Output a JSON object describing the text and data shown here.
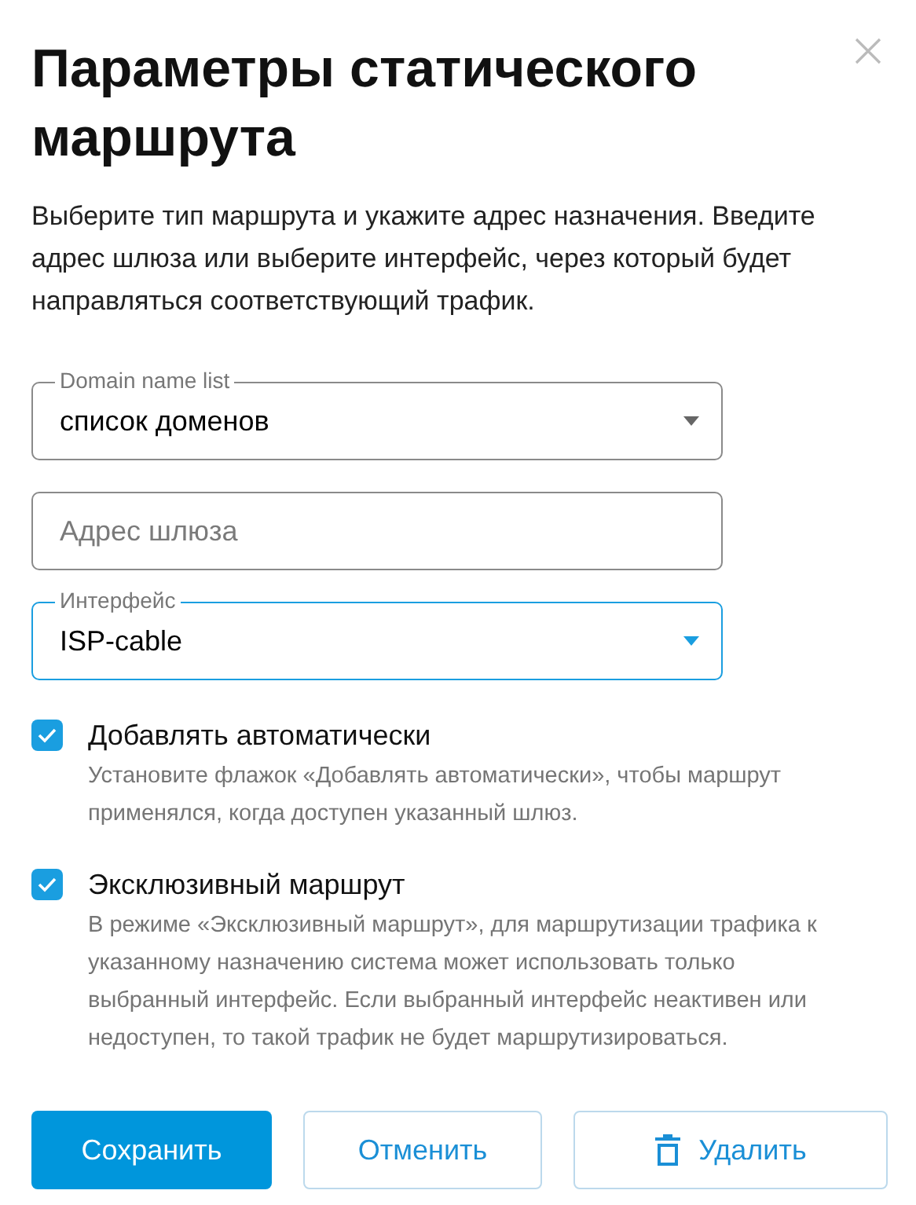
{
  "dialog": {
    "title": "Параметры статического маршрута",
    "description": "Выберите тип маршрута и укажите адрес назначения. Введите адрес шлюза или выберите интерфейс, через который будет направляться соответствующий трафик.",
    "fields": [
      {
        "kind": "select",
        "label": "Domain name list",
        "value": "список доменов",
        "focused": false
      },
      {
        "kind": "text",
        "placeholder": "Адрес шлюза",
        "focused": false
      },
      {
        "kind": "select",
        "label": "Интерфейс",
        "value": "ISP-cable",
        "focused": true
      }
    ],
    "options": [
      {
        "label": "Добавлять автоматически",
        "hint": "Установите флажок «Добавлять автоматически», чтобы маршрут применялся, когда доступен указанный шлюз.",
        "checked": true
      },
      {
        "label": "Эксклюзивный маршрут",
        "hint": "В режиме «Эксклюзивный маршрут», для маршрутизации трафика к указанному назначению система может использовать только выбранный интерфейс. Если выбранный интерфейс неактивен или недоступен, то такой трафик не будет маршрутизироваться.",
        "checked": true
      }
    ],
    "buttons": [
      {
        "kind": "primary",
        "label": "Сохранить"
      },
      {
        "kind": "outline",
        "label": "Отменить"
      },
      {
        "kind": "delete",
        "label": "Удалить"
      }
    ]
  }
}
